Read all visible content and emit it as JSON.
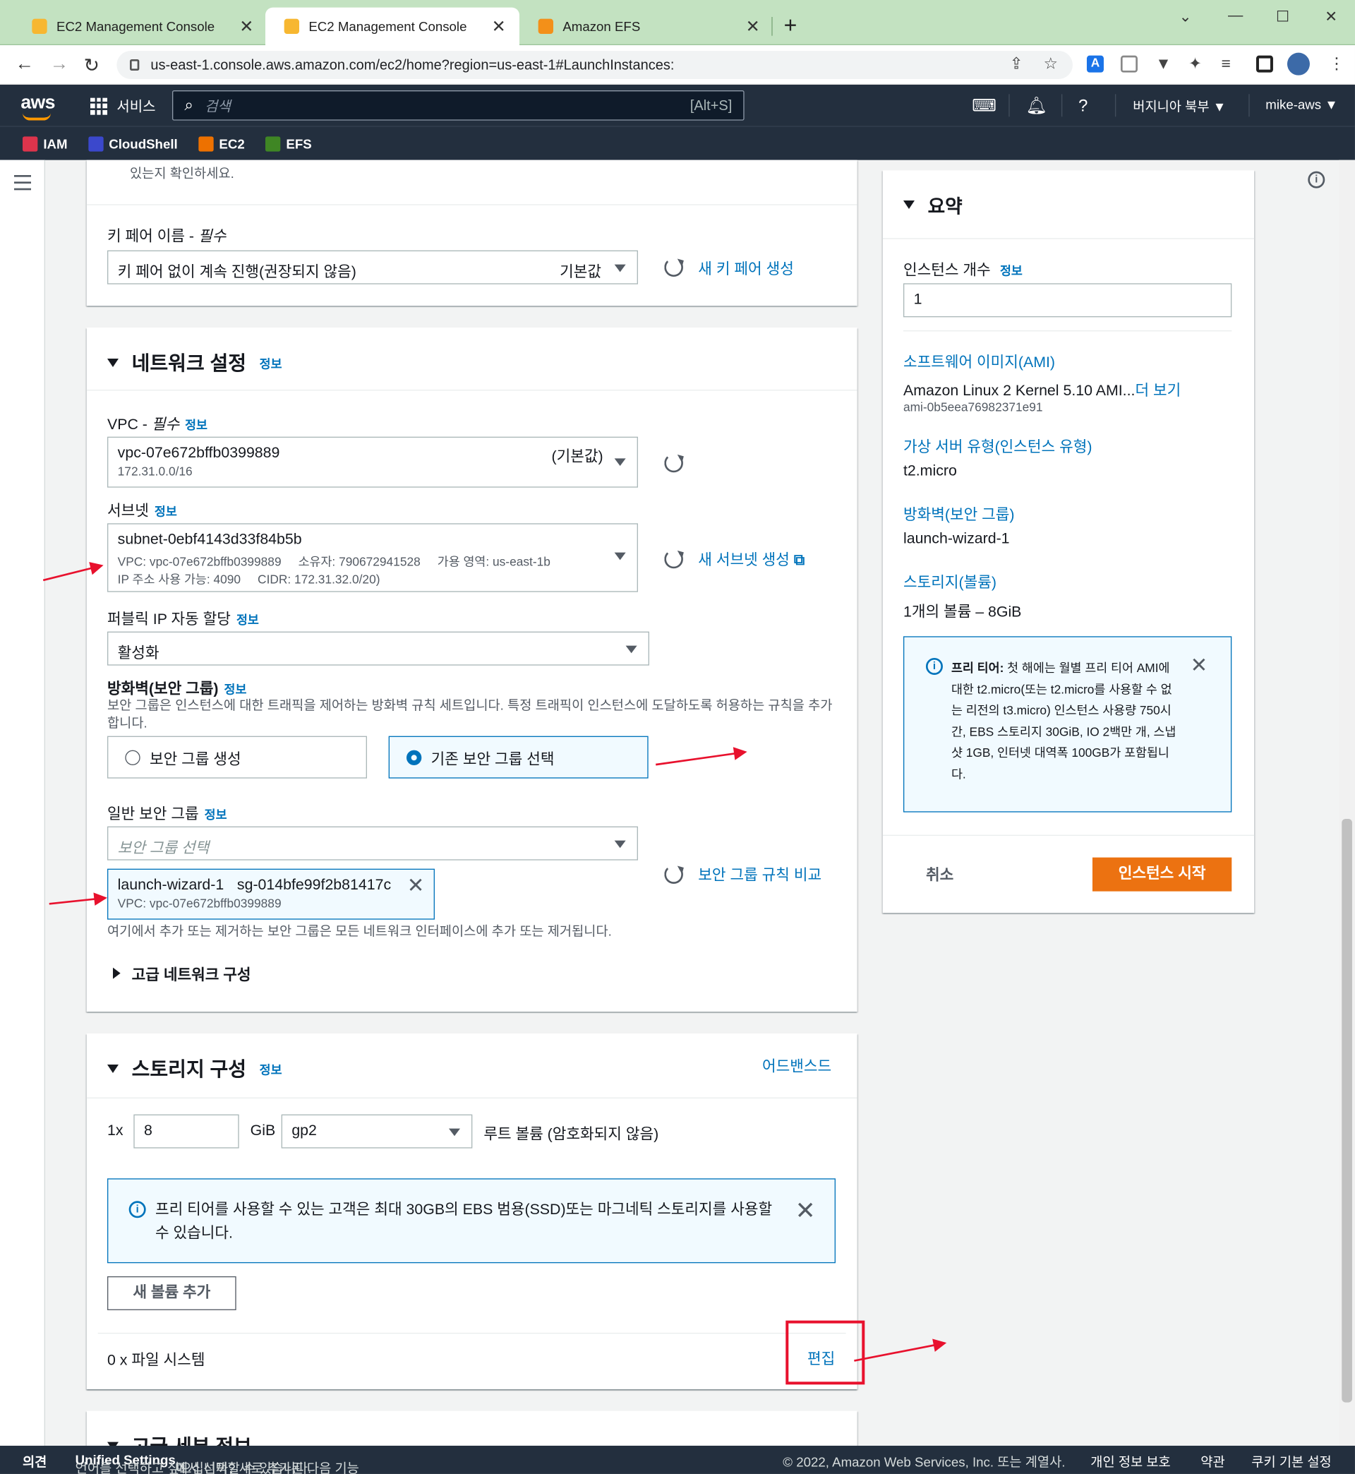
{
  "browser": {
    "tabs": [
      {
        "title": "EC2 Management Console",
        "active": false
      },
      {
        "title": "EC2 Management Console",
        "active": true
      },
      {
        "title": "Amazon EFS",
        "active": false
      }
    ],
    "new_tab": "+",
    "url": "us-east-1.console.aws.amazon.com/ec2/home?region=us-east-1#LaunchInstances:"
  },
  "aws_nav": {
    "logo": "aws",
    "services_label": "서비스",
    "search_placeholder": "검색",
    "search_shortcut": "[Alt+S]",
    "region": "버지니아 북부 ▼",
    "user": "mike-aws ▼",
    "favorites": [
      {
        "label": "IAM",
        "color": "#dd344c"
      },
      {
        "label": "CloudShell",
        "color": "#3b48cc"
      },
      {
        "label": "EC2",
        "color": "#ed7100"
      },
      {
        "label": "EFS",
        "color": "#3f8624"
      }
    ]
  },
  "keypair": {
    "top_text": "있는지 확인하세요.",
    "label": "키 페어 이름 - ",
    "required": "필수",
    "value": "키 페어 없이 계속 진행(권장되지 않음)",
    "default_tag": "기본값",
    "create_link": "새 키 페어 생성"
  },
  "network": {
    "title": "네트워크 설정",
    "info": "정보",
    "vpc_label": "VPC - ",
    "vpc_required": "필수",
    "vpc_value": "vpc-07e672bffb0399889",
    "vpc_default": "(기본값)",
    "vpc_cidr": "172.31.0.0/16",
    "subnet_label": "서브넷",
    "subnet_value": "subnet-0ebf4143d33f84b5b",
    "subnet_vpc": "VPC: vpc-07e672bffb0399889",
    "subnet_owner": "소유자: 790672941528",
    "subnet_az": "가용 영역: us-east-1b",
    "subnet_ips": "IP 주소 사용 가능: 4090",
    "subnet_cidr": "CIDR: 172.31.32.0/20)",
    "create_subnet_link": "새 서브넷 생성",
    "public_ip_label": "퍼블릭 IP 자동 할당",
    "public_ip_value": "활성화",
    "firewall_label": "방화벽(보안 그룹)",
    "firewall_desc": "보안 그룹은 인스턴스에 대한 트래픽을 제어하는 방화벽 규칙 세트입니다. 특정 트래픽이 인스턴스에 도달하도록 허용하는 규칙을 추가합니다.",
    "radio_create": "보안 그룹 생성",
    "radio_existing": "기존 보안 그룹 선택",
    "common_sg_label": "일반 보안 그룹",
    "sg_placeholder": "보안 그룹 선택",
    "sg_name": "launch-wizard-1",
    "sg_id": "sg-014bfe99f2b81417c",
    "sg_vpc": "VPC: vpc-07e672bffb0399889",
    "compare_link": "보안 그룹 규칙 비교",
    "sg_note": "여기에서 추가 또는 제거하는 보안 그룹은 모든 네트워크 인터페이스에 추가 또는 제거됩니다.",
    "advanced": "고급 네트워크 구성"
  },
  "storage": {
    "title": "스토리지 구성",
    "info": "정보",
    "advanced_link": "어드밴스드",
    "count": "1x",
    "size": "8",
    "unit": "GiB",
    "type": "gp2",
    "root_label": "루트 볼륨  (암호화되지 않음)",
    "alert": "프리 티어를 사용할 수 있는 고객은 최대 30GB의 EBS 범용(SSD)또는 마그네틱 스토리지를 사용할 수 있습니다.",
    "add_volume": "새 볼륨 추가",
    "fs_label": "0 x 파일 시스템",
    "edit": "편집"
  },
  "summary": {
    "title": "요약",
    "instances_label": "인스턴스 개수",
    "info": "정보",
    "instances_value": "1",
    "ami_label": "소프트웨어 이미지(AMI)",
    "ami_value": "Amazon Linux 2 Kernel 5.10 AMI...",
    "ami_more": "더 보기",
    "ami_id": "ami-0b5eea76982371e91",
    "type_label": "가상 서버 유형(인스턴스 유형)",
    "type_value": "t2.micro",
    "fw_label": "방화벽(보안 그룹)",
    "fw_value": "launch-wizard-1",
    "storage_label": "스토리지(볼륨)",
    "storage_value": "1개의 볼륨 – 8GiB",
    "free_tier_title": "프리 티어:",
    "free_tier_text": "첫 해에는 월별 프리 티어 AMI에 대한 t2.micro(또는 t2.micro를 사용할 수 없는 리전의 t3.micro) 인스턴스 사용량 750시간, EBS 스토리지 30GiB, IO 2백만 개, 스냅샷 1GB, 인터넷 대역폭 100GB가 포함됩니다.",
    "cancel": "취소",
    "launch": "인스턴스 시작"
  },
  "hidden_section": "고급 세부 정보",
  "footer": {
    "feedback": "의견",
    "lang_text": "언어를 선택하고 싶으십니까? 새로 추가된 다음 기능",
    "unified": "Unified Settings",
    "lang_text2": "에서 선택할 수 있습니다.",
    "copyright": "© 2022, Amazon Web Services, Inc. 또는 계열사.",
    "privacy": "개인 정보 보호",
    "terms": "약관",
    "cookies": "쿠키 기본 설정"
  },
  "colors": {
    "aws_nav": "#232f3e",
    "primary_button": "#ec7211",
    "link": "#0073bb",
    "annotation": "#e8112d"
  }
}
